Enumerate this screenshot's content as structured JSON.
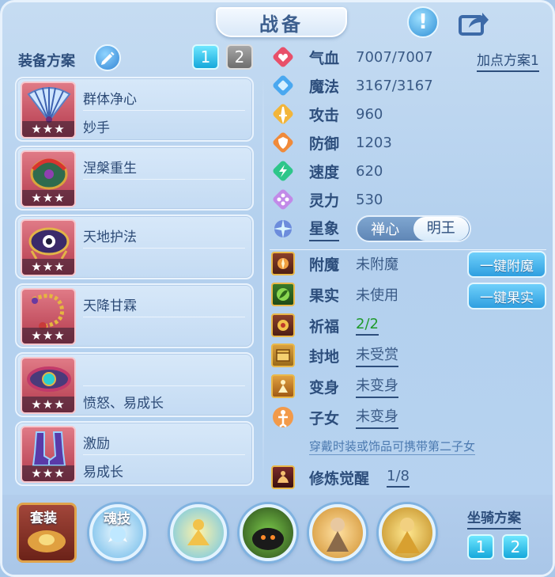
{
  "title": "战备",
  "equip_plan": {
    "label": "装备方案",
    "tabs": [
      "1",
      "2"
    ],
    "active_tab": "1",
    "items": [
      {
        "line1": "群体净心",
        "line2": "妙手",
        "stars": "★★★",
        "icon": "fan-icon"
      },
      {
        "line1": "涅槃重生",
        "line2": "",
        "stars": "★★★",
        "icon": "helmet-icon"
      },
      {
        "line1": "天地护法",
        "line2": "",
        "stars": "★★★",
        "icon": "necklace-icon"
      },
      {
        "line1": "天降甘霖",
        "line2": "",
        "stars": "★★★",
        "icon": "beads-icon"
      },
      {
        "line1": "",
        "line2": "愤怒、易成长",
        "stars": "★★★",
        "icon": "belt-icon"
      },
      {
        "line1": "激励",
        "line2": "易成长",
        "stars": "★★★",
        "icon": "boots-icon"
      }
    ]
  },
  "stats": {
    "hp": {
      "label": "气血",
      "value": "7007/7007"
    },
    "mp": {
      "label": "魔法",
      "value": "3167/3167"
    },
    "atk": {
      "label": "攻击",
      "value": "960"
    },
    "def": {
      "label": "防御",
      "value": "1203"
    },
    "spd": {
      "label": "速度",
      "value": "620"
    },
    "spi": {
      "label": "灵力",
      "value": "530"
    }
  },
  "point_plan": "加点方案1",
  "star": {
    "label": "星象",
    "options": [
      "禅心",
      "明王"
    ],
    "selected": "明王"
  },
  "extras": {
    "enchant": {
      "label": "附魔",
      "value": "未附魔",
      "button": "一键附魔"
    },
    "fruit": {
      "label": "果实",
      "value": "未使用",
      "button": "一键果实"
    },
    "bless": {
      "label": "祈福",
      "value": "2/2"
    },
    "fief": {
      "label": "封地",
      "value": "未受赏"
    },
    "transform": {
      "label": "变身",
      "value": "未变身"
    },
    "child": {
      "label": "子女",
      "value": "未变身"
    },
    "hint": "穿戴时装或饰品可携带第二子女",
    "awaken": {
      "label": "修炼觉醒",
      "value": "1/8"
    }
  },
  "bottom": {
    "suit_label": "套装",
    "soul_label": "魂技",
    "mount_label": "坐骑方案",
    "mount_tabs": [
      "1",
      "2"
    ]
  },
  "colors": {
    "accent": "#2d4e7c",
    "active_tab": "#15a8db",
    "bless_value": "#1f9a2b"
  }
}
